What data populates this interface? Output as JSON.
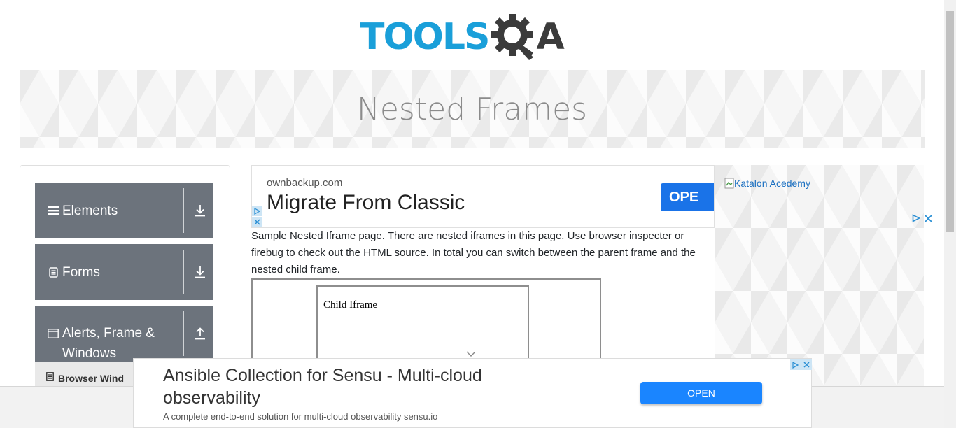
{
  "logo": {
    "text_main": "TOOLS",
    "text_q": "Q",
    "text_a": "A"
  },
  "banner": {
    "title": "Nested Frames"
  },
  "sidebar": {
    "groups": [
      {
        "label": "Elements",
        "icon": "hamburger-icon",
        "arrow": "download-icon"
      },
      {
        "label": "Forms",
        "icon": "document-icon",
        "arrow": "download-icon"
      },
      {
        "label": "Alerts, Frame & Windows",
        "icon": "window-icon",
        "arrow": "upload-icon"
      }
    ],
    "active_sub_item": "Browser Wind"
  },
  "top_ad": {
    "domain": "ownbackup.com",
    "title": "Migrate From Classic",
    "button": "OPE"
  },
  "description": "Sample Nested Iframe page. There are nested iframes in this page. Use browser inspecter or firebug to check out the HTML source. In total you can switch between the parent frame and the nested child frame.",
  "child_frame": {
    "text": "Child Iframe"
  },
  "right_ad": {
    "alt_text": "Katalon Acedemy"
  },
  "bottom_ad": {
    "title": "Ansible Collection for Sensu - Multi-cloud observability",
    "subtitle": "A complete end-to-end solution for multi-cloud observability sensu.io",
    "button": "OPEN"
  },
  "colors": {
    "brand_blue": "#1a9fd9",
    "brand_dark": "#3b3b3b",
    "sidebar_group": "#6c737c",
    "ad_button": "#1a85ff"
  }
}
